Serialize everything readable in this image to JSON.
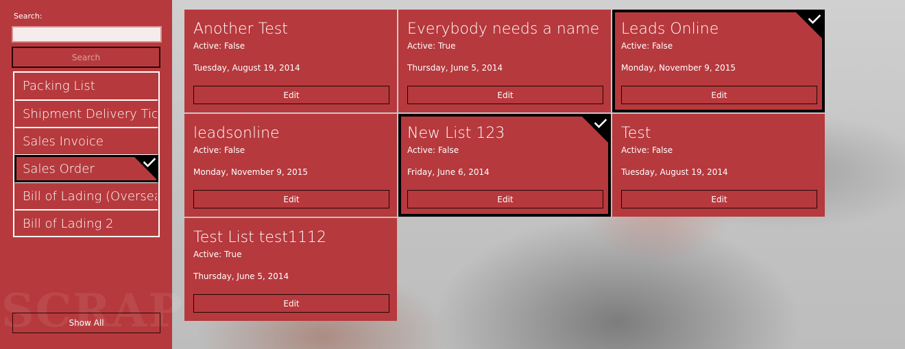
{
  "sidebar": {
    "search_label": "Search:",
    "search_value": "",
    "search_placeholder": "",
    "search_button_label": "Search",
    "watermark": "SCRAP",
    "items": [
      {
        "label": "Packing List",
        "selected": false
      },
      {
        "label": "Shipment Delivery Ticket",
        "selected": false
      },
      {
        "label": "Sales Invoice",
        "selected": false
      },
      {
        "label": "Sales Order",
        "selected": true
      },
      {
        "label": "Bill of Lading (Overseas)",
        "selected": false
      },
      {
        "label": "Bill of Lading 2",
        "selected": false
      }
    ],
    "show_all_label": "Show All"
  },
  "cards": [
    {
      "title": "Another Test",
      "active": "Active: False",
      "date": "Tuesday, August 19, 2014",
      "edit_label": "Edit",
      "selected": false
    },
    {
      "title": "Everybody needs a name",
      "active": "Active: True",
      "date": "Thursday, June 5, 2014",
      "edit_label": "Edit",
      "selected": false
    },
    {
      "title": "Leads Online",
      "active": "Active: False",
      "date": "Monday, November 9, 2015",
      "edit_label": "Edit",
      "selected": true
    },
    {
      "title": "leadsonline",
      "active": "Active: False",
      "date": "Monday, November 9, 2015",
      "edit_label": "Edit",
      "selected": false
    },
    {
      "title": "New List 123",
      "active": "Active: False",
      "date": "Friday, June 6, 2014",
      "edit_label": "Edit",
      "selected": true
    },
    {
      "title": "Test",
      "active": "Active: False",
      "date": "Tuesday, August 19, 2014",
      "edit_label": "Edit",
      "selected": false
    },
    {
      "title": "Test List test1112",
      "active": "Active: True",
      "date": "Thursday, June 5, 2014",
      "edit_label": "Edit",
      "selected": false
    }
  ],
  "colors": {
    "accent": "#b6393d",
    "selection": "#000000",
    "text": "#ffffff"
  },
  "icons": {
    "selection_mark": "check-icon"
  }
}
